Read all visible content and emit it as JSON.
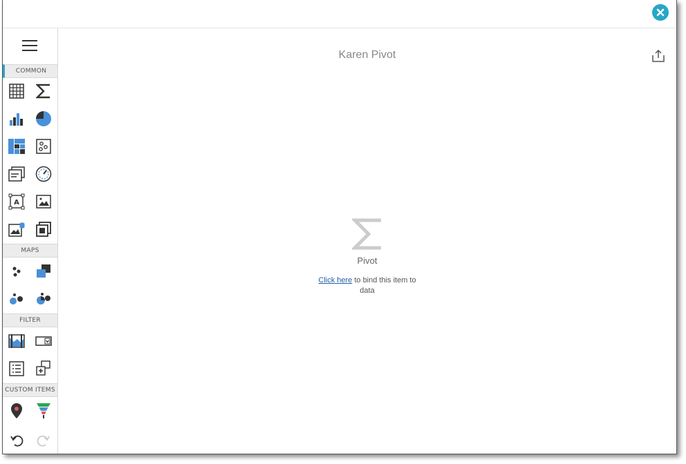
{
  "window": {
    "close_icon": "close-icon",
    "accent_color": "#27a7c7"
  },
  "sidebar": {
    "menu_icon": "hamburger-menu-icon",
    "sections": {
      "common": "COMMON",
      "maps": "MAPS",
      "filter": "FILTER",
      "custom_items": "CUSTOM ITEMS"
    },
    "common_items": [
      "grid-icon",
      "pivot-icon",
      "chart-icon",
      "pie-icon",
      "treemap-icon",
      "scatter-icon",
      "cards-icon",
      "gauge-icon",
      "text-box-icon",
      "image-icon",
      "bound-image-icon",
      "group-icon"
    ],
    "map_items": [
      "geo-point-map-icon",
      "choropleth-map-icon",
      "bubble-map-icon",
      "pie-map-icon"
    ],
    "filter_items": [
      "range-filter-icon",
      "combo-box-icon",
      "list-box-icon",
      "tree-view-icon"
    ],
    "custom_items": [
      "map-pin-icon",
      "funnel-icon"
    ],
    "undo_icon": "undo-icon",
    "redo_icon": "redo-icon"
  },
  "main": {
    "title": "Karen Pivot",
    "export_icon": "export-icon",
    "placeholder": {
      "icon": "sigma-icon",
      "label": "Pivot",
      "link_text": "Click here",
      "bind_text": " to bind this item to data"
    }
  }
}
